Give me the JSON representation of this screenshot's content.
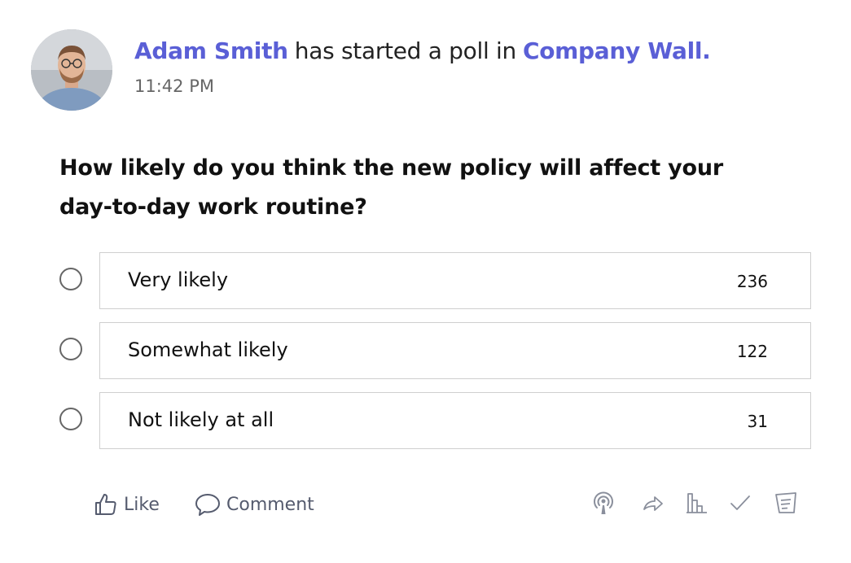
{
  "post": {
    "author": "Adam Smith",
    "action": "has started a poll in",
    "group": "Company Wall.",
    "time": "11:42 PM"
  },
  "poll": {
    "question": "How likely do you think the new policy will affect your day-to-day work routine?",
    "options": [
      {
        "label": "Very likely",
        "count": "236"
      },
      {
        "label": "Somewhat likely",
        "count": "122"
      },
      {
        "label": "Not likely at all",
        "count": "31"
      }
    ]
  },
  "actions": {
    "like_label": "Like",
    "comment_label": "Comment",
    "icons": [
      "broadcast-icon",
      "share-icon",
      "stats-icon",
      "check-icon",
      "notes-icon"
    ]
  },
  "colors": {
    "link": "#5a5fd6",
    "icon": "#8a8f9c",
    "border": "#cfcfcf"
  }
}
